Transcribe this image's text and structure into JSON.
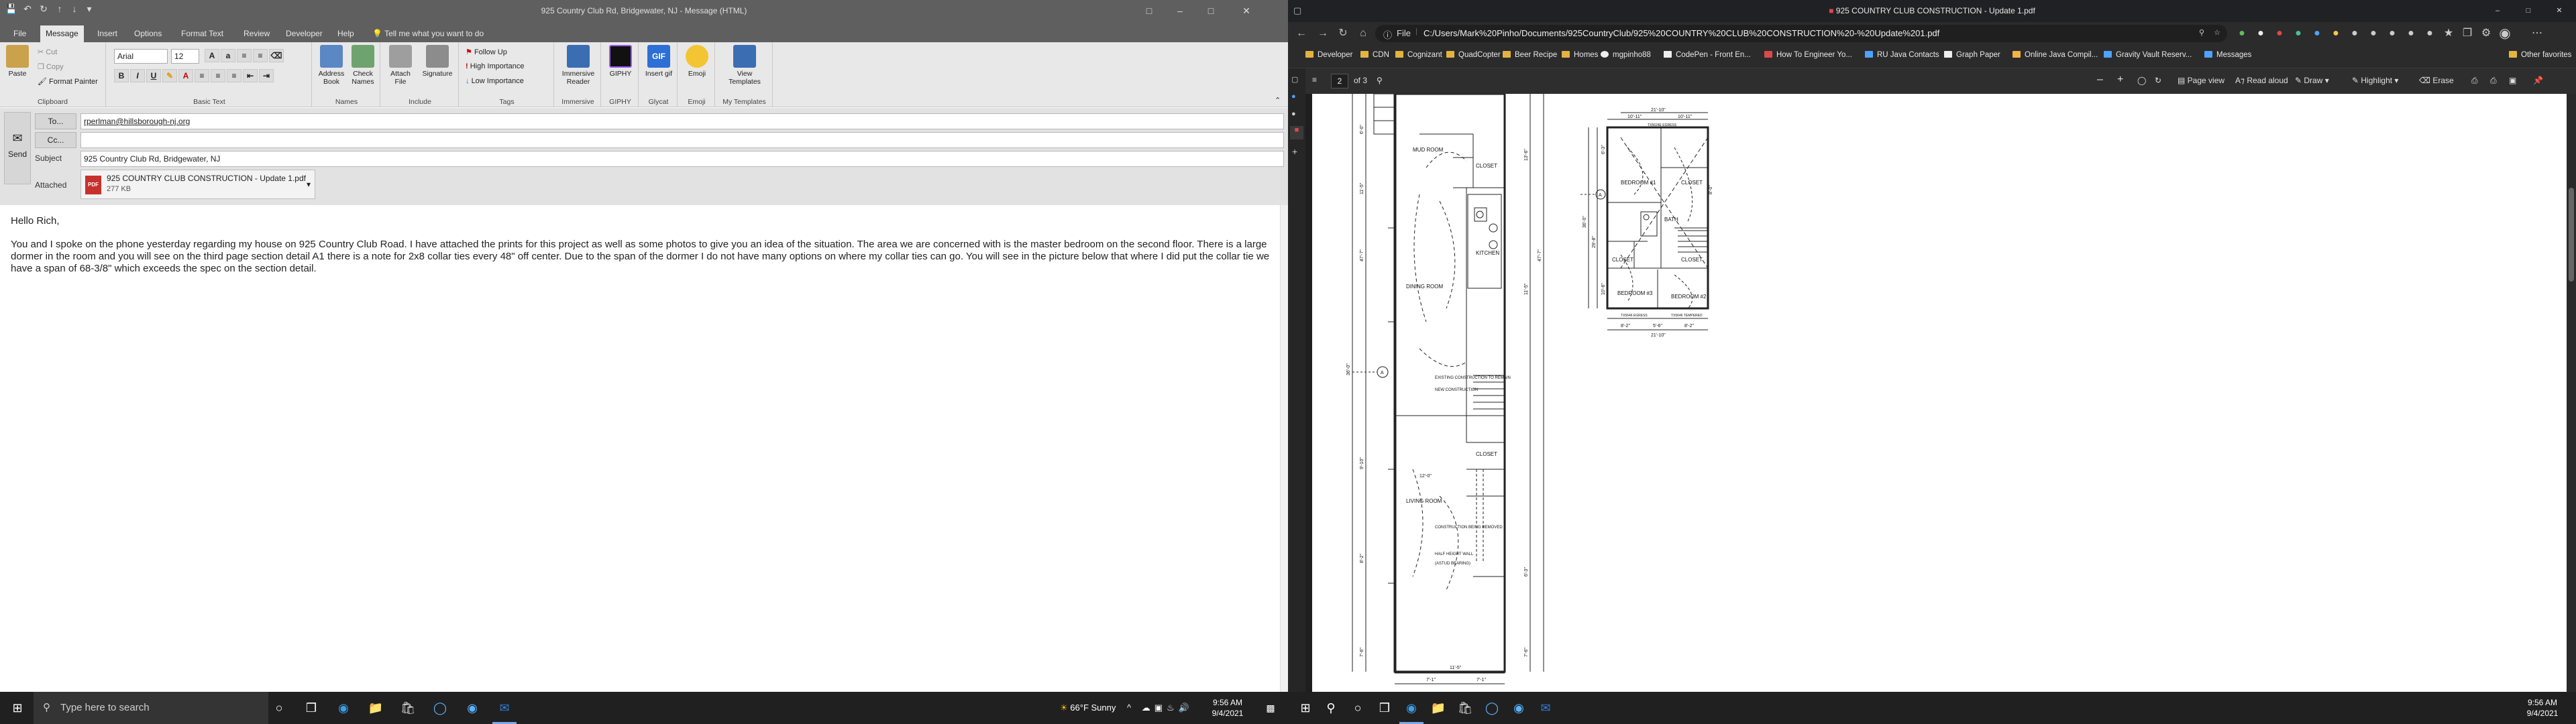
{
  "outlook": {
    "title": "925 Country Club Rd, Bridgewater, NJ  -  Message (HTML)",
    "tabs": [
      "File",
      "Message",
      "Insert",
      "Options",
      "Format Text",
      "Review",
      "Developer",
      "Help"
    ],
    "tell_me": "Tell me what you want to do",
    "ribbon": {
      "clipboard": {
        "paste": "Paste",
        "cut": "Cut",
        "copy": "Copy",
        "format_painter": "Format Painter",
        "group": "Clipboard"
      },
      "basic_text": {
        "font": "Arial",
        "size": "12",
        "group": "Basic Text"
      },
      "names": {
        "address_book": "Address Book",
        "check_names": "Check Names",
        "group": "Names"
      },
      "include": {
        "attach_file": "Attach File",
        "signature": "Signature",
        "group": "Include"
      },
      "tags": {
        "follow_up": "Follow Up",
        "high_importance": "High Importance",
        "low_importance": "Low Importance",
        "group": "Tags"
      },
      "immersive": {
        "reader": "Immersive Reader",
        "group": "Immersive"
      },
      "giphy": {
        "label": "GIPHY",
        "group": "GIPHY"
      },
      "glycat": {
        "label": "Insert gif",
        "group": "Glycat"
      },
      "emoji": {
        "label": "Emoji",
        "group": "Emoji"
      },
      "templates": {
        "label": "View Templates",
        "group": "My Templates"
      }
    },
    "send": "Send",
    "to_label": "To...",
    "to_value": "rperlman@hillsborough-nj.org",
    "cc_label": "Cc...",
    "subject_label": "Subject",
    "subject_value": "925 Country Club Rd, Bridgewater, NJ",
    "attached_label": "Attached",
    "attachment_name": "925 COUNTRY CLUB CONSTRUCTION - Update 1.pdf",
    "attachment_size": "277 KB",
    "body_greeting": "Hello Rich,",
    "body_paragraph": "You and I spoke on the phone yesterday regarding my house on 925 Country Club Road. I have attached the prints for this project as well as some photos to give you an idea of the situation. The area we are concerned with is the master bedroom on the second floor. There is a large dormer in the room and you will see on the third page section detail A1 there is a note for 2x8 collar ties every 48\" off center. Due to the span of the dormer I do not have many options on where my collar ties can go. You will see in the picture below that where I did put the collar tie we have a span of 68-3/8\" which exceeds the spec on the section detail."
  },
  "taskbar_left": {
    "search_placeholder": "Type here to search",
    "weather": "66°F  Sunny",
    "time": "9:56 AM",
    "date": "9/4/2021"
  },
  "edge": {
    "tab_title": "925 COUNTRY CLUB CONSTRUCTION - Update 1.pdf",
    "file_label": "File",
    "url": "C:/Users/Mark%20Pinho/Documents/925CountryClub/925%20COUNTRY%20CLUB%20CONSTRUCTION%20-%20Update%201.pdf",
    "favorites": [
      "Developer",
      "CDN",
      "Cognizant",
      "QuadCopter",
      "Beer Recipe",
      "Homes",
      "mgpinho88",
      "CodePen - Front En...",
      "How To Engineer Yo...",
      "RU Java Contacts",
      "Graph Paper",
      "Online Java Compil...",
      "Gravity Vault Reserv...",
      "Messages"
    ],
    "other_favorites": "Other favorites",
    "pdf": {
      "page": "2",
      "of": "of 3",
      "page_view": "Page view",
      "read_aloud": "Read aloud",
      "draw": "Draw",
      "highlight": "Highlight",
      "erase": "Erase"
    }
  },
  "taskbar_right": {
    "time": "9:56 AM",
    "date": "9/4/2021"
  },
  "floorplan": {
    "first_floor": {
      "rooms": [
        "MUD ROOM",
        "CLOSET",
        "DINING ROOM",
        "KITCHEN",
        "LIVING ROOM",
        "CLOSET"
      ],
      "notes": [
        "EXISTING CONSTRUCTION TO REMAIN",
        "NEW CONSTRUCTION",
        "CONSTRUCTION BEING REMOVED",
        "HALF HEIGHT WALL",
        "(ASTUD BEARING)"
      ],
      "dims_vertical": [
        "47'-7\"",
        "36'-0\"",
        "11'-5\"",
        "6'-0\"",
        "9'-10\"",
        "8'-2\"",
        "7'-6\"",
        "11'-5\"",
        "13'-6\"",
        "47'-7\"",
        "6'-3\"",
        "7'-6\""
      ],
      "dims_horizontal": [
        "7'-1\"",
        "11'-5\"",
        "7'-1\"",
        "12'-0\"",
        "4'-1\"",
        "4'-4\"",
        "3'-10\""
      ]
    },
    "second_floor": {
      "rooms": [
        "BEDROOM #1",
        "CLOSET",
        "BATH",
        "CLOSET",
        "CLOSET",
        "BEDROOM #3",
        "BEDROOM #2"
      ],
      "dims_top": [
        "21'-10\"",
        "10'-11\"",
        "10'-11\""
      ],
      "dims_bottom": [
        "8'-2\"",
        "5'-6\"",
        "8'-2\"",
        "21'-10\""
      ],
      "dims_side": [
        "36'-0\"",
        "29'-8\"",
        "6'-3\"",
        "8'-0\"",
        "10'-6\""
      ],
      "notes": [
        "TX5624E EGRESS",
        "TX5646 EGRESS",
        "TX5646 TEMPERED"
      ]
    },
    "section_mark": "A"
  }
}
